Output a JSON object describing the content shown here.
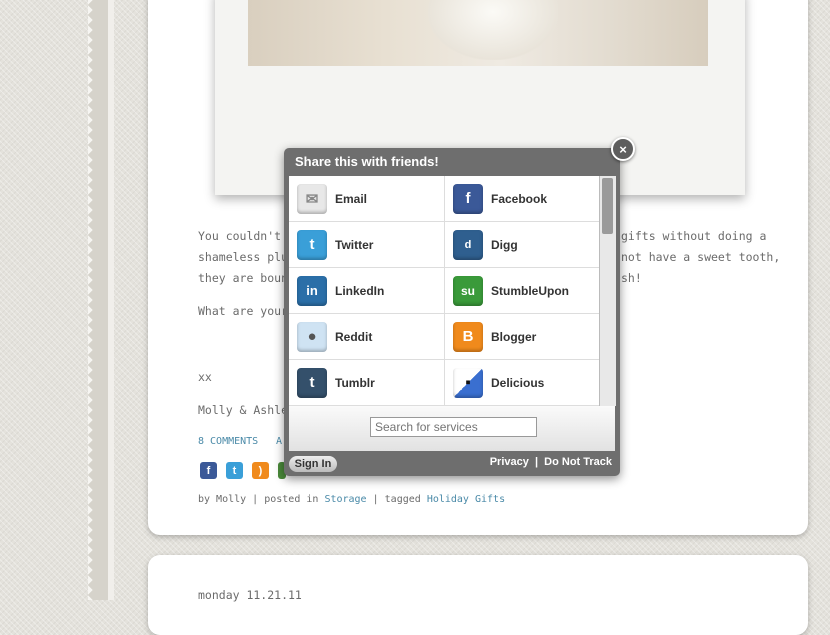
{
  "post": {
    "line1a": "You couldn't po",
    "line1b": "gifts without doing a",
    "line2a": "shameless plug",
    "line2b": "not have a sweet tooth,",
    "line3a": "they are bound",
    "line3b": "sh!",
    "question": "What are your f",
    "signoff1": "xx",
    "signoff2": "Molly & Ashley",
    "comments": "8 COMMENTS",
    "comments_more": "A",
    "meta_by": "by Molly | posted in ",
    "meta_category": "Storage",
    "meta_tagged": " | tagged ",
    "meta_tag1": "Holiday",
    "meta_tag2": "Gifts"
  },
  "next_post": {
    "date": "monday 11.21.11"
  },
  "share": {
    "title": "Share this with friends!",
    "close": "×",
    "services": [
      {
        "label": "Email",
        "icon": "email-icon",
        "color": "#e8e8e8",
        "glyph": "✉"
      },
      {
        "label": "Facebook",
        "icon": "facebook-icon",
        "color": "#3b5998",
        "glyph": "f"
      },
      {
        "label": "Twitter",
        "icon": "twitter-icon",
        "color": "#3a9fd8",
        "glyph": "t"
      },
      {
        "label": "Digg",
        "icon": "digg-icon",
        "color": "#2f5f8f",
        "glyph": "d"
      },
      {
        "label": "LinkedIn",
        "icon": "linkedin-icon",
        "color": "#2b6fa8",
        "glyph": "in"
      },
      {
        "label": "StumbleUpon",
        "icon": "stumbleupon-icon",
        "color": "#3a9a3a",
        "glyph": "su"
      },
      {
        "label": "Reddit",
        "icon": "reddit-icon",
        "color": "#cfe3f3",
        "glyph": "●"
      },
      {
        "label": "Blogger",
        "icon": "blogger-icon",
        "color": "#f08a1c",
        "glyph": "B"
      },
      {
        "label": "Tumblr",
        "icon": "tumblr-icon",
        "color": "#34506b",
        "glyph": "t"
      },
      {
        "label": "Delicious",
        "icon": "delicious-icon",
        "color": "#3a6fd0",
        "glyph": "▪"
      }
    ],
    "search_placeholder": "Search for services",
    "sign_in": "Sign In",
    "privacy": "Privacy  |  Do Not Track"
  }
}
